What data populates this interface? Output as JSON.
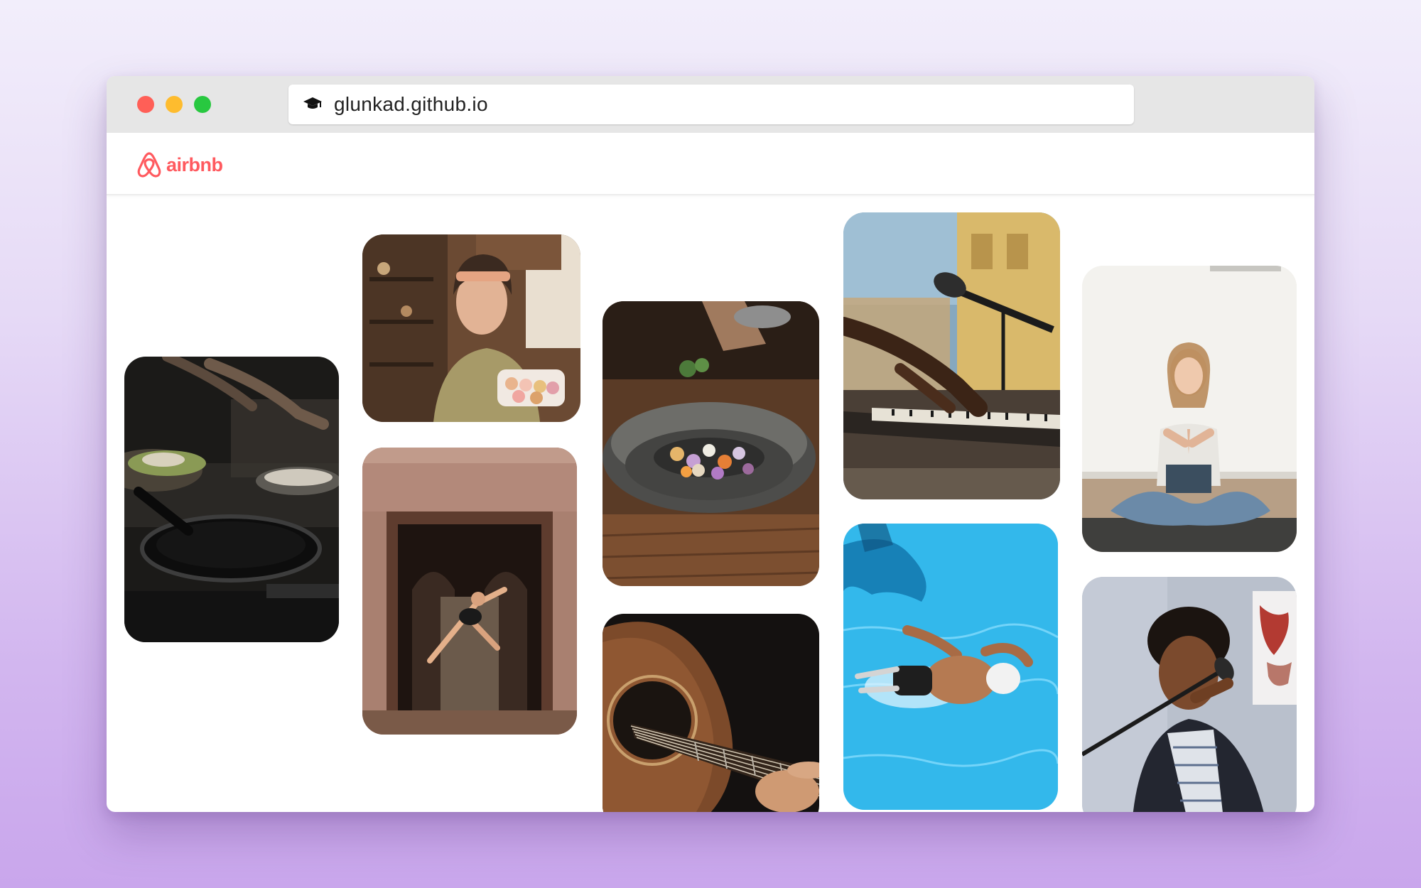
{
  "browser": {
    "url": "glunkad.github.io",
    "url_icon": "graduation-cap-icon"
  },
  "app": {
    "logo_text": "airbnb",
    "logo_icon": "airbnb-belo-icon",
    "brand_color": "#ff5a5f"
  },
  "gallery": {
    "photos": [
      {
        "name": "cooking-pans-photo",
        "subject": "hands cooking with pans"
      },
      {
        "name": "macarons-chef-photo",
        "subject": "woman holding macarons"
      },
      {
        "name": "dancer-doorway-photo",
        "subject": "dancer leaping in doorway"
      },
      {
        "name": "stone-bowl-salt-photo",
        "subject": "salting food in stone bowl"
      },
      {
        "name": "acoustic-guitar-photo",
        "subject": "acoustic guitar"
      },
      {
        "name": "keyboard-microphone-photo",
        "subject": "keyboard and microphone"
      },
      {
        "name": "swimmer-pool-photo",
        "subject": "swimmer in pool"
      },
      {
        "name": "yoga-meditation-photo",
        "subject": "woman meditating"
      },
      {
        "name": "singer-microphone-photo",
        "subject": "singer with microphone"
      }
    ]
  }
}
